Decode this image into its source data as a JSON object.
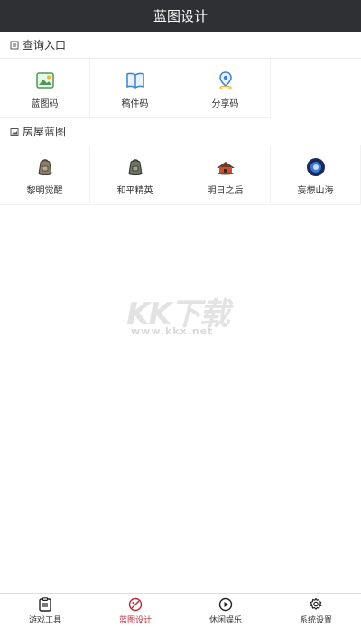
{
  "header": {
    "title": "蓝图设计"
  },
  "sections": {
    "query": {
      "title": "查询入口",
      "items": [
        {
          "label": "蓝图码",
          "icon": "image-icon"
        },
        {
          "label": "稿件码",
          "icon": "book-icon"
        },
        {
          "label": "分享码",
          "icon": "location-pin-icon"
        }
      ]
    },
    "house": {
      "title": "房屋蓝图",
      "items": [
        {
          "label": "黎明觉醒",
          "icon": "backpack-icon"
        },
        {
          "label": "和平精英",
          "icon": "backpack-icon"
        },
        {
          "label": "明日之后",
          "icon": "house-icon"
        },
        {
          "label": "妄想山海",
          "icon": "orb-icon"
        }
      ]
    }
  },
  "watermark": {
    "text": "KK下载",
    "url": "www.kkx.net"
  },
  "tabbar": {
    "tabs": [
      {
        "label": "游戏工具",
        "icon": "clipboard-icon",
        "active": false
      },
      {
        "label": "蓝图设计",
        "icon": "palette-icon",
        "active": true
      },
      {
        "label": "休闲娱乐",
        "icon": "play-icon",
        "active": false
      },
      {
        "label": "系统设置",
        "icon": "gear-icon",
        "active": false
      }
    ]
  },
  "colors": {
    "header_bg": "#2e3033",
    "active_tab": "#c0283a",
    "icon_blue": "#3f7fd6"
  }
}
